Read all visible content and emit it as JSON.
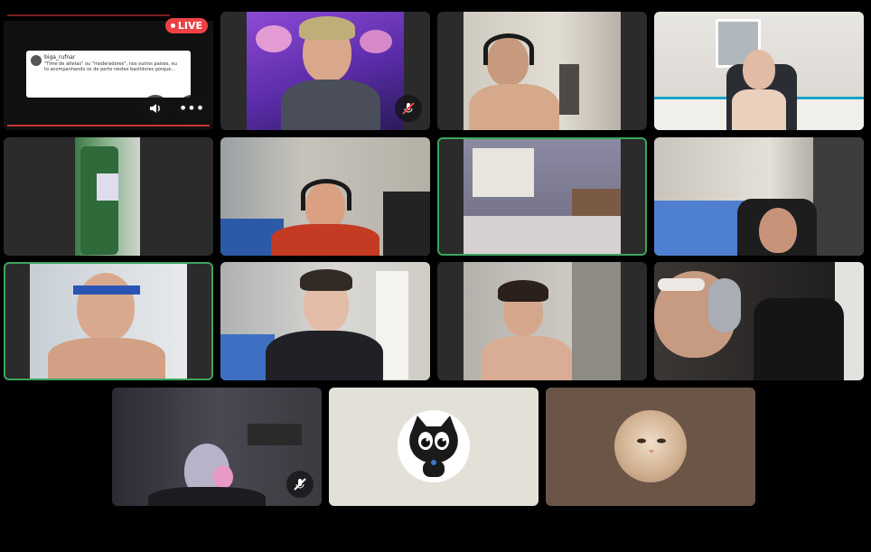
{
  "stream": {
    "live_badge": "LIVE",
    "tweet_user": "biga_rufnar",
    "tweet_text": "\"Time de atletas\" ou \"moderadores\", nos outros paises, eu to acompanhando os de perto nestes bastidores porque..."
  },
  "tiles": [
    {
      "id": "stream",
      "icon": "speaker-icon"
    },
    {
      "id": "purple-bg",
      "icon": "muted-mic-icon"
    },
    {
      "id": "headset-man"
    },
    {
      "id": "phone-user"
    },
    {
      "id": "green-bag"
    },
    {
      "id": "red-shirt"
    },
    {
      "id": "empty-bedroom",
      "speaking": true
    },
    {
      "id": "bed-room-user"
    },
    {
      "id": "blue-headband",
      "speaking": true
    },
    {
      "id": "grey-room"
    },
    {
      "id": "curly-hair"
    },
    {
      "id": "white-sunglasses"
    },
    {
      "id": "pink-headset",
      "icon": "muted-mic-icon"
    },
    {
      "id": "black-cat-avatar"
    },
    {
      "id": "cat-photo-avatar"
    }
  ],
  "colors": {
    "speaking": "#3ba55c",
    "live": "#ed4245",
    "tile_bg": "#2b2b2b",
    "avatar_bg_light": "#e3e0d8",
    "avatar_bg_brown": "#6b5546"
  }
}
